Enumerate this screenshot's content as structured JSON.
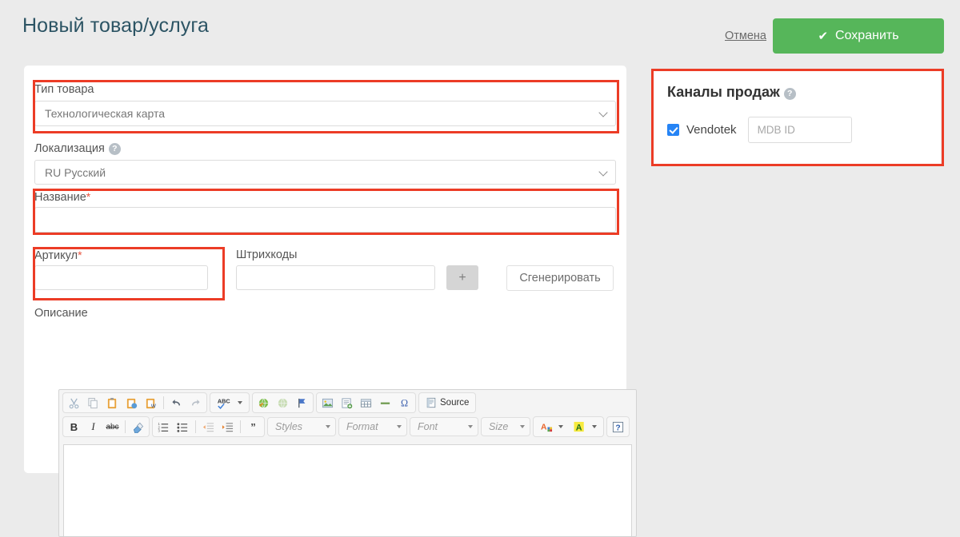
{
  "header": {
    "title": "Новый товар/услуга",
    "cancel_label": "Отмена",
    "save_label": "Сохранить",
    "save_icon": "check-icon",
    "save_color": "#56b65a"
  },
  "form": {
    "product_type": {
      "label": "Тип товара",
      "value": "Технологическая карта",
      "highlighted": true
    },
    "localization": {
      "label": "Локализация",
      "help_icon": "help-circle-icon",
      "value": "RU Русский"
    },
    "name": {
      "label": "Название",
      "required_mark": "*",
      "value": "",
      "highlighted": true
    },
    "article": {
      "label": "Артикул",
      "required_mark": "*",
      "value": "",
      "highlighted": true
    },
    "barcodes": {
      "label": "Штрихкоды",
      "value": "",
      "add_label": "+",
      "generate_label": "Сгенерировать"
    },
    "description": {
      "label": "Описание",
      "value": ""
    }
  },
  "sales_channels": {
    "title": "Каналы продаж",
    "help_icon": "help-circle-icon",
    "highlighted": true,
    "channels": [
      {
        "name": "Vendotek",
        "checked": true,
        "input_placeholder": "MDB ID",
        "input_value": ""
      }
    ]
  },
  "editor": {
    "toolbar_row1": [
      {
        "group": [
          {
            "icon": "cut-icon",
            "glyph": "✂",
            "disabled": true
          },
          {
            "icon": "copy-icon",
            "glyph": "⧉",
            "disabled": true
          },
          {
            "icon": "paste-icon",
            "glyph": "📋"
          },
          {
            "icon": "paste-text-icon",
            "glyph": "📋"
          },
          {
            "icon": "paste-from-word-icon",
            "glyph": "📋"
          },
          {
            "separator": true
          },
          {
            "icon": "undo-icon",
            "glyph": "↩"
          },
          {
            "icon": "redo-icon",
            "glyph": "↪",
            "disabled": true
          }
        ]
      },
      {
        "group": [
          {
            "icon": "spellcheck-icon",
            "glyph": "ABC",
            "has_caret": true
          }
        ]
      },
      {
        "group": [
          {
            "icon": "link-icon",
            "glyph": "🔗"
          },
          {
            "icon": "unlink-icon",
            "glyph": "🔗",
            "disabled": true
          },
          {
            "icon": "anchor-icon",
            "glyph": "⚑"
          }
        ]
      },
      {
        "group": [
          {
            "icon": "image-icon",
            "glyph": "🖼"
          },
          {
            "icon": "page-break-icon",
            "glyph": "▤"
          },
          {
            "icon": "table-icon",
            "glyph": "▦"
          },
          {
            "icon": "horizontal-rule-icon",
            "glyph": "▬"
          },
          {
            "icon": "special-char-icon",
            "glyph": "Ω"
          }
        ]
      },
      {
        "group": [
          {
            "icon": "source-icon",
            "glyph": "▤",
            "label": "Source"
          }
        ]
      }
    ],
    "toolbar_row2": [
      {
        "group": [
          {
            "icon": "bold-icon",
            "glyph": "B"
          },
          {
            "icon": "italic-icon",
            "glyph": "I"
          },
          {
            "icon": "strikethrough-icon",
            "glyph": "abc"
          },
          {
            "separator": true
          },
          {
            "icon": "remove-format-icon",
            "glyph": "🧽"
          }
        ]
      },
      {
        "group": [
          {
            "icon": "numbered-list-icon",
            "glyph": "≡"
          },
          {
            "icon": "bulleted-list-icon",
            "glyph": "≔"
          },
          {
            "separator": true
          },
          {
            "icon": "outdent-icon",
            "glyph": "⇤",
            "disabled": true
          },
          {
            "icon": "indent-icon",
            "glyph": "⇥"
          },
          {
            "separator": true
          },
          {
            "icon": "blockquote-icon",
            "glyph": "❞"
          }
        ]
      }
    ],
    "dropdowns": [
      {
        "name": "styles-dropdown",
        "label": "Styles"
      },
      {
        "name": "format-dropdown",
        "label": "Format"
      },
      {
        "name": "font-dropdown",
        "label": "Font"
      },
      {
        "name": "size-dropdown",
        "label": "Size"
      }
    ],
    "color_buttons": [
      {
        "icon": "text-color-icon",
        "glyph": "A"
      },
      {
        "icon": "background-color-icon",
        "glyph": "A"
      }
    ],
    "help_button": {
      "icon": "help-icon",
      "glyph": "?"
    }
  },
  "colors": {
    "page_background": "#ebebeb",
    "card_background": "#ffffff",
    "title": "#2c5464",
    "accent_green": "#56b65a",
    "annotation_red": "#ec3c26",
    "checkbox_blue": "#2684f5",
    "required_star": "#e8543f"
  }
}
